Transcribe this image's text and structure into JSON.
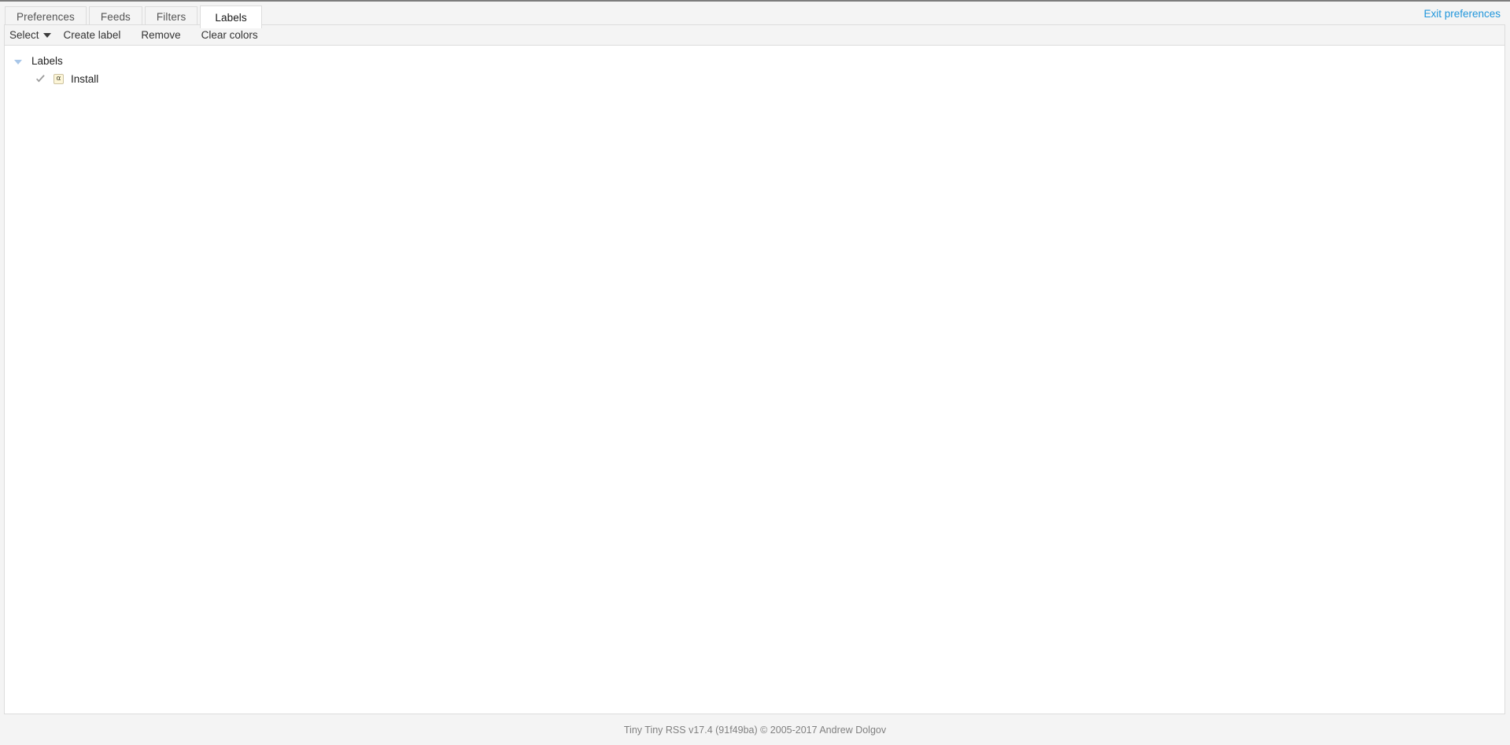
{
  "colors": {
    "accent_link": "#2196db",
    "panel_bg": "#ffffff",
    "chrome_bg": "#f4f4f4",
    "border": "#dcdcdc",
    "label_swatch_bg": "#fdf6d8",
    "label_swatch_border": "#ccc2a0",
    "expander": "#a8c6e8",
    "check": "#9a9a9a",
    "footer_text": "#808080"
  },
  "header": {
    "tabs": [
      {
        "label": "Preferences",
        "active": false
      },
      {
        "label": "Feeds",
        "active": false
      },
      {
        "label": "Filters",
        "active": false
      },
      {
        "label": "Labels",
        "active": true
      }
    ],
    "exit_link": "Exit preferences"
  },
  "toolbar": {
    "items": [
      {
        "label": "Select",
        "icon": "chevron-down-icon",
        "has_caret": true
      },
      {
        "label": "Create label",
        "has_caret": false
      },
      {
        "label": "Remove",
        "has_caret": false
      },
      {
        "label": "Clear colors",
        "has_caret": false
      }
    ]
  },
  "tree": {
    "root": {
      "label": "Labels",
      "expanded": true,
      "expander_icon": "triangle-down-icon"
    },
    "items": [
      {
        "label": "Install",
        "checked": true,
        "check_icon": "check-icon",
        "swatch_glyph": "α",
        "swatch_bg": "#fdf6d8",
        "swatch_fg": "#4a4a3a"
      }
    ]
  },
  "footer": {
    "text": "Tiny Tiny RSS v17.4 (91f49ba) © 2005-2017 Andrew Dolgov"
  }
}
